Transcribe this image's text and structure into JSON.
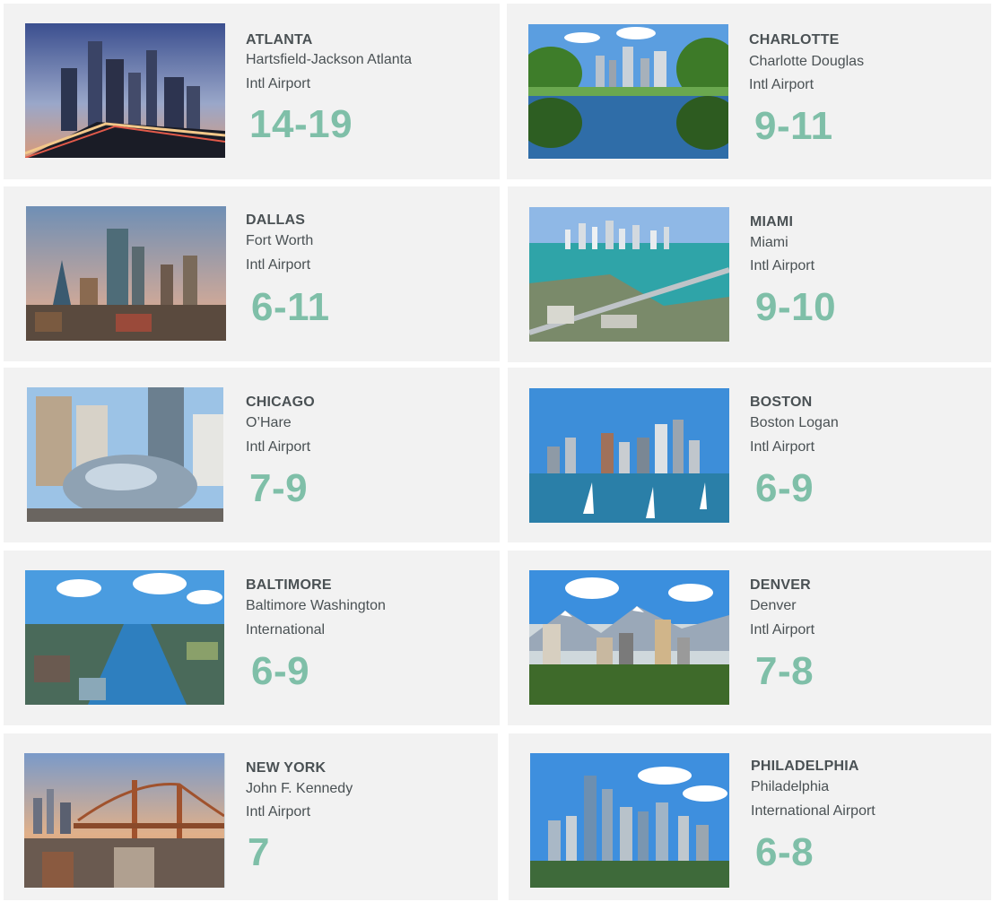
{
  "colors": {
    "card_bg": "#f2f2f2",
    "text": "#4a5154",
    "accent": "#7fbfa8"
  },
  "cards": [
    {
      "city": "ATLANTA",
      "airport_line1": "Hartsfield-Jackson Atlanta",
      "airport_line2": "Intl Airport",
      "range": "14-19",
      "image": "atlanta-skyline-image"
    },
    {
      "city": "CHARLOTTE",
      "airport_line1": "Charlotte Douglas",
      "airport_line2": "Intl Airport",
      "range": "9-11",
      "image": "charlotte-park-image"
    },
    {
      "city": "DALLAS",
      "airport_line1": "Fort Worth",
      "airport_line2": "Intl Airport",
      "range": "6-11",
      "image": "dallas-skyline-image"
    },
    {
      "city": "MIAMI",
      "airport_line1": "Miami",
      "airport_line2": "Intl Airport",
      "range": "9-10",
      "image": "miami-aerial-image"
    },
    {
      "city": "CHICAGO",
      "airport_line1": "O’Hare",
      "airport_line2": "Intl Airport",
      "range": "7-9",
      "image": "chicago-bean-image"
    },
    {
      "city": "BOSTON",
      "airport_line1": "Boston Logan",
      "airport_line2": "Intl Airport",
      "range": "6-9",
      "image": "boston-harbor-image"
    },
    {
      "city": "BALTIMORE",
      "airport_line1": "Baltimore Washington",
      "airport_line2": "International",
      "range": "6-9",
      "image": "baltimore-harbor-image"
    },
    {
      "city": "DENVER",
      "airport_line1": "Denver",
      "airport_line2": "Intl Airport",
      "range": "7-8",
      "image": "denver-mountains-image"
    },
    {
      "city": "NEW YORK",
      "airport_line1": "John F. Kennedy",
      "airport_line2": "Intl Airport",
      "range": "7",
      "image": "new-york-bridge-image"
    },
    {
      "city": "PHILADELPHIA",
      "airport_line1": "Philadelphia",
      "airport_line2": "International Airport",
      "range": "6-8",
      "image": "philadelphia-skyline-image"
    }
  ]
}
